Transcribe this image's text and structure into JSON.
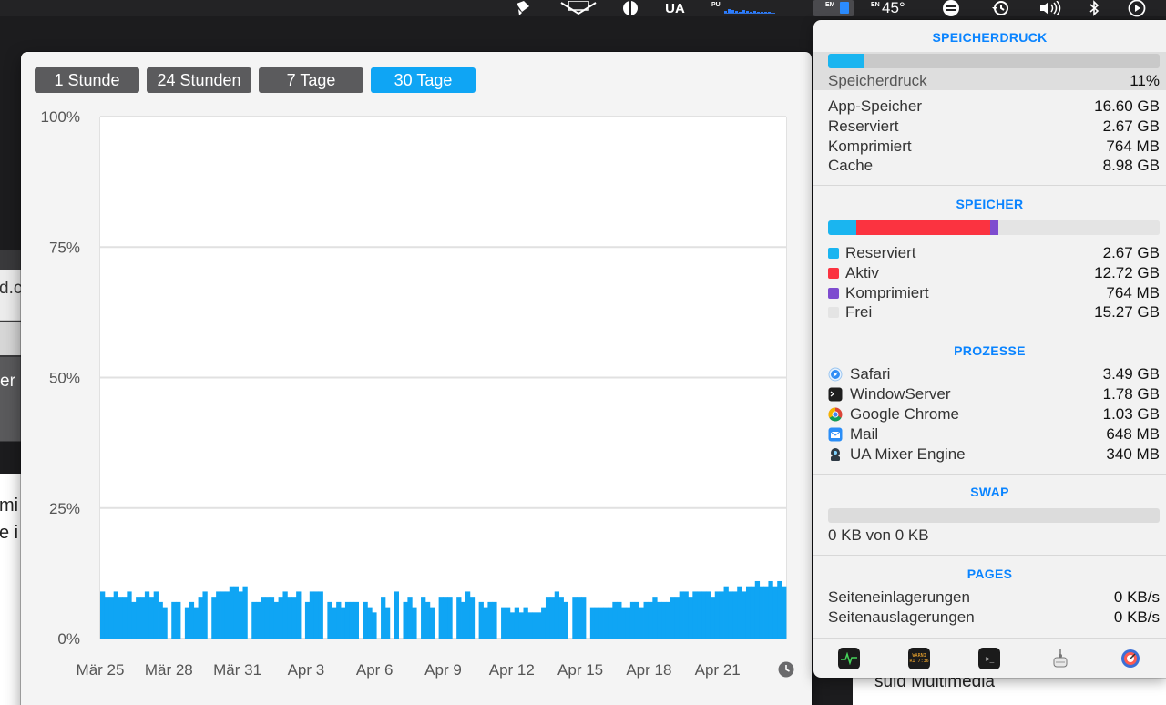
{
  "menubar": {
    "temp_label": "45°",
    "ua_label": "UA",
    "cpu_letters": "PU",
    "mem_letters": "EM",
    "sensor_letters": "EN",
    "cpu_levels": [
      0.2,
      0.35,
      0.3,
      0.15,
      0.1,
      0.25,
      0.2,
      0.1,
      0.15,
      0.1,
      0.1,
      0.1,
      0.1
    ]
  },
  "background": {
    "fragment_1": "d.c",
    "fragment_2": "er",
    "fragment_3": "mi",
    "fragment_4": "e i",
    "bottom_text": "suid Multimedia"
  },
  "history": {
    "ranges": [
      {
        "label": "1 Stunde",
        "active": false
      },
      {
        "label": "24 Stunden",
        "active": false
      },
      {
        "label": "7 Tage",
        "active": false
      },
      {
        "label": "30 Tage",
        "active": true
      }
    ]
  },
  "chart_data": {
    "type": "area",
    "title": "",
    "xlabel": "",
    "ylabel": "",
    "ylim": [
      0,
      100
    ],
    "y_ticks": [
      "100%",
      "75%",
      "50%",
      "25%",
      "0%"
    ],
    "x_ticks": [
      "Mär 25",
      "Mär 28",
      "Mär 31",
      "Apr 3",
      "Apr 6",
      "Apr 9",
      "Apr 12",
      "Apr 15",
      "Apr 18",
      "Apr 21"
    ],
    "x_range": [
      "Mär 25",
      "Apr 24"
    ],
    "grid": true,
    "fill_color": "#0fa5f4",
    "series": [
      {
        "values": [
          9,
          8,
          8,
          9,
          8,
          8,
          9,
          7,
          8,
          8,
          9,
          8,
          9,
          7,
          6,
          0,
          7,
          7,
          0,
          6,
          7,
          6,
          8,
          9,
          0,
          8,
          9,
          9,
          9,
          10,
          10,
          9,
          10,
          0,
          7,
          7,
          8,
          8,
          8,
          7,
          8,
          9,
          8,
          8,
          9,
          0,
          7,
          9,
          9,
          9,
          0,
          7,
          6,
          7,
          6,
          7,
          7,
          7,
          0,
          7,
          6,
          5,
          0,
          8,
          6,
          0,
          9,
          0,
          7,
          8,
          6,
          0,
          8,
          7,
          6,
          0,
          8,
          8,
          8,
          0,
          8,
          7,
          9,
          8,
          0,
          7,
          6,
          7,
          7,
          0,
          6,
          6,
          5,
          6,
          5,
          6,
          5,
          5,
          5,
          6,
          8,
          8,
          9,
          8,
          7,
          0,
          8,
          8,
          8,
          0,
          6,
          6,
          6,
          6,
          6,
          7,
          7,
          6,
          6,
          7,
          7,
          6,
          7,
          7,
          8,
          7,
          7,
          7,
          8,
          8,
          9,
          9,
          8,
          9,
          9,
          9,
          9,
          8,
          9,
          9,
          10,
          9,
          9,
          10,
          9,
          10,
          10,
          11,
          10,
          10,
          11,
          10,
          11,
          10
        ]
      }
    ]
  },
  "panel": {
    "pressure": {
      "title": "SPEICHERDRUCK",
      "fraction": 0.11,
      "label": "Speicherdruck",
      "value": "11%",
      "rows": [
        {
          "label": "App-Speicher",
          "value": "16.60 GB"
        },
        {
          "label": "Reserviert",
          "value": "2.67 GB"
        },
        {
          "label": "Komprimiert",
          "value": "764 MB"
        },
        {
          "label": "Cache",
          "value": "8.98 GB"
        }
      ]
    },
    "memory": {
      "title": "SPEICHER",
      "legend": [
        {
          "label": "Reserviert",
          "value": "2.67 GB",
          "color": "#1ab5f0",
          "amount": 2.67
        },
        {
          "label": "Aktiv",
          "value": "12.72 GB",
          "color": "#fb3340",
          "amount": 12.72
        },
        {
          "label": "Komprimiert",
          "value": "764 MB",
          "color": "#7e4ccf",
          "amount": 0.764
        },
        {
          "label": "Frei",
          "value": "15.27 GB",
          "color": "#e4e4e4",
          "amount": 15.27
        }
      ]
    },
    "processes": {
      "title": "PROZESSE",
      "items": [
        {
          "name": "Safari",
          "value": "3.49 GB",
          "icon": "safari-icon"
        },
        {
          "name": "WindowServer",
          "value": "1.78 GB",
          "icon": "terminal-icon"
        },
        {
          "name": "Google Chrome",
          "value": "1.03 GB",
          "icon": "chrome-icon"
        },
        {
          "name": "Mail",
          "value": "648 MB",
          "icon": "mail-icon"
        },
        {
          "name": "UA Mixer Engine",
          "value": "340 MB",
          "icon": "ua-mixer-icon"
        }
      ]
    },
    "swap": {
      "title": "SWAP",
      "fraction": 0,
      "text": "0 KB von 0 KB"
    },
    "pages": {
      "title": "PAGES",
      "rows": [
        {
          "label": "Seiteneinlagerungen",
          "value": "0 KB/s"
        },
        {
          "label": "Seitenauslagerungen",
          "value": "0 KB/s"
        }
      ]
    },
    "footer": {
      "console_text": "WARNI",
      "console_sub": "RI 7:36",
      "terminal_prompt": ">_"
    }
  }
}
